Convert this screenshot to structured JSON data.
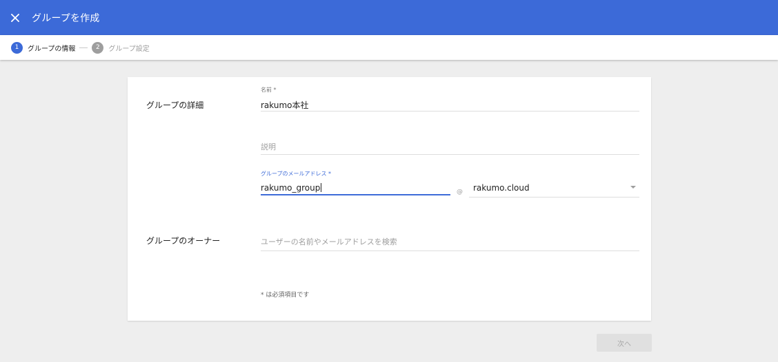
{
  "header": {
    "title": "グループを作成",
    "bg_color": "#3c6ad8"
  },
  "stepper": {
    "steps": [
      {
        "number": "1",
        "label": "グループの情報",
        "active": true,
        "color": "#3c6ad8"
      },
      {
        "number": "2",
        "label": "グループ設定",
        "active": false,
        "color": "#9e9e9e"
      }
    ]
  },
  "form": {
    "details_section_label": "グループの詳細",
    "name": {
      "label": "名前 *",
      "value": "rakumo本社"
    },
    "description": {
      "placeholder": "説明"
    },
    "email": {
      "label": "グループのメールアドレス *",
      "value": "rakumo_group",
      "at_symbol": "@",
      "domain": "rakumo.cloud"
    },
    "owner_section_label": "グループのオーナー",
    "owner_search": {
      "placeholder": "ユーザーの名前やメールアドレスを検索"
    },
    "required_note": "* は必須項目です"
  },
  "footer": {
    "next_label": "次へ"
  }
}
